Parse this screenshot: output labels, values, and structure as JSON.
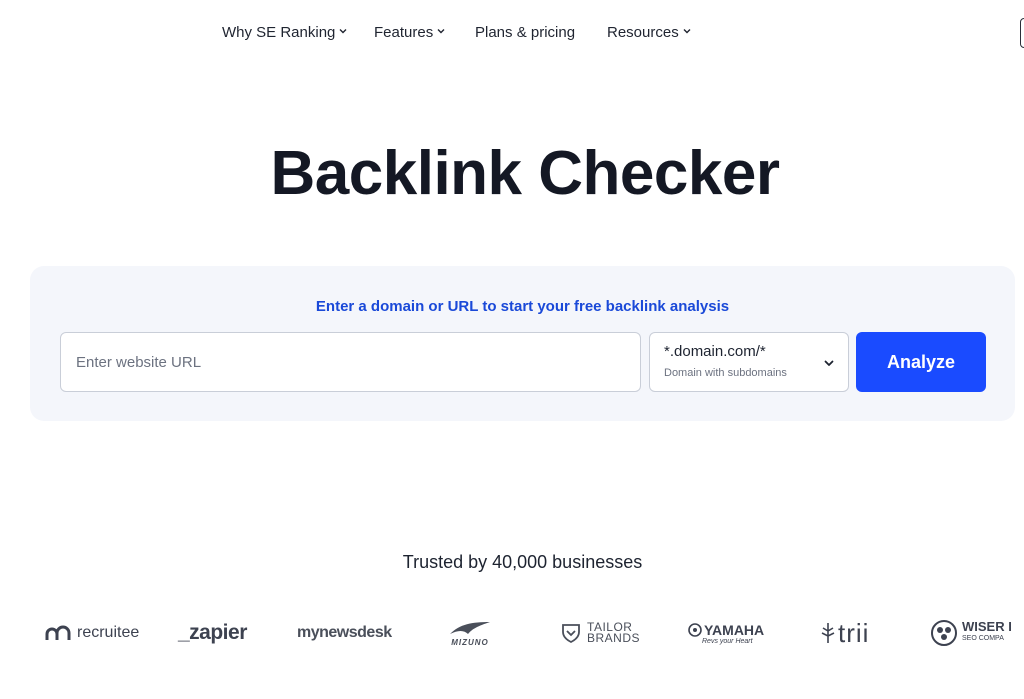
{
  "nav": {
    "items": [
      {
        "label": "Why SE Ranking",
        "has_dropdown": true
      },
      {
        "label": "Features",
        "has_dropdown": true
      },
      {
        "label": "Plans & pricing",
        "has_dropdown": false
      },
      {
        "label": "Resources",
        "has_dropdown": true
      }
    ]
  },
  "hero": {
    "title": "Backlink Checker"
  },
  "search": {
    "caption": "Enter a domain or URL to start your free backlink analysis",
    "url_placeholder": "Enter website URL",
    "url_value": "",
    "scope_value": "*.domain.com/*",
    "scope_description": "Domain with subdomains",
    "analyze_label": "Analyze"
  },
  "trusted": {
    "heading": "Trusted by 40,000 businesses",
    "logos": [
      {
        "name": "recruitee",
        "text": "recruitee",
        "icon": "recruitee-logo-icon"
      },
      {
        "name": "zapier",
        "text": "_zapier"
      },
      {
        "name": "mynewsdesk",
        "text": "mynewsdesk"
      },
      {
        "name": "mizuno",
        "text": "MIZUNO",
        "icon": "mizuno-runbird-icon"
      },
      {
        "name": "tailor-brands",
        "text_line1": "TAILOR",
        "text_line2": "BRANDS",
        "icon": "tailor-brands-shield-icon"
      },
      {
        "name": "yamaha",
        "text": "YAMAHA",
        "tagline": "Revs your Heart",
        "icon": "yamaha-tuning-forks-icon"
      },
      {
        "name": "trii",
        "text": "trii",
        "icon": "trii-tree-icon"
      },
      {
        "name": "wiser",
        "text_line1": "WISER I",
        "text_line2": "SEO COMPA",
        "icon": "wiser-brain-icon"
      }
    ]
  },
  "colors": {
    "accent": "#1a4bff",
    "caption_blue": "#1a49d8",
    "panel_bg": "#f4f6fb",
    "title": "#141824"
  }
}
